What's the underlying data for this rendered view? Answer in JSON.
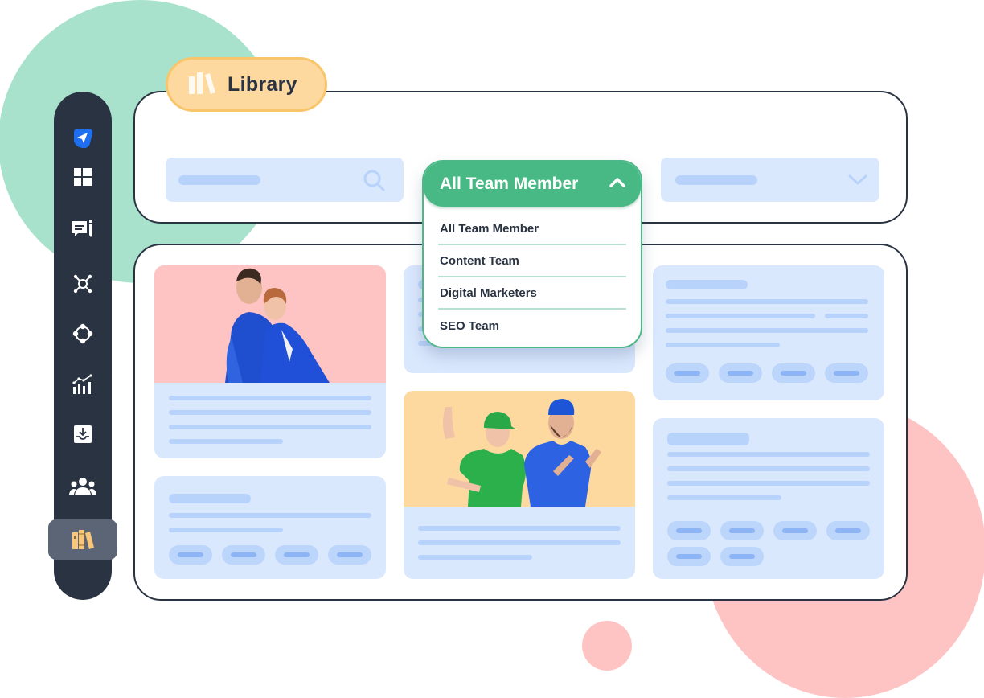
{
  "colors": {
    "sidebar_bg": "#2a3342",
    "sidebar_active_bg": "#5c6575",
    "accent_blue": "#1e6ff0",
    "accent_green": "#48b985",
    "library_tag_bg": "#fdd9a0",
    "library_tag_border": "#f8c56a",
    "placeholder_bg": "#dae8fe",
    "placeholder_bar": "#b8d3fb",
    "deco_green": "#a9e2cc",
    "deco_pink": "#fec4c4",
    "photo_bg_pink": "#fec4c4",
    "photo_bg_orange": "#fdd9a0"
  },
  "header": {
    "tag_icon": "books-icon",
    "tag_label": "Library"
  },
  "sidebar": {
    "items": [
      {
        "icon": "send-logo-icon",
        "active": false
      },
      {
        "icon": "dashboard-grid-icon",
        "active": false
      },
      {
        "icon": "message-edit-icon",
        "active": false
      },
      {
        "icon": "network-hub-icon",
        "active": false
      },
      {
        "icon": "nodes-diamond-icon",
        "active": false
      },
      {
        "icon": "analytics-chart-icon",
        "active": false
      },
      {
        "icon": "inbox-download-icon",
        "active": false
      },
      {
        "icon": "team-users-icon",
        "active": false
      },
      {
        "icon": "library-books-icon",
        "active": true
      }
    ]
  },
  "filters": {
    "search_icon": "search-icon",
    "select_icon": "chevron-down-icon",
    "team_dropdown": {
      "selected": "All Team Member",
      "expanded": true,
      "icon": "chevron-up-icon",
      "options": [
        "All Team Member",
        "Content Team",
        "Digital Marketers",
        "SEO Team"
      ]
    }
  },
  "cards": [
    {
      "id": "photo-card-couple",
      "image": "Two people in blue jackets standing back to back"
    },
    {
      "id": "tags-card-left",
      "pills": 4
    },
    {
      "id": "partial-card-middle"
    },
    {
      "id": "photo-card-pointing",
      "image": "Two people in green and blue polo shirts and caps pointing"
    },
    {
      "id": "tags-card-right-top",
      "pills": 4
    },
    {
      "id": "tags-card-right-bottom",
      "pills": 6
    }
  ]
}
